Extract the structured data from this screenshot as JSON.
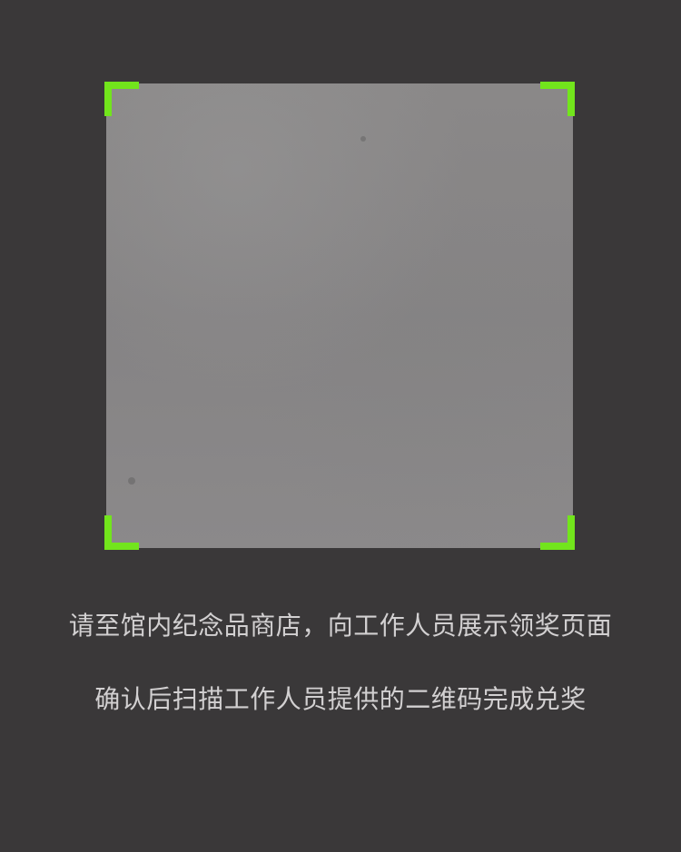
{
  "scanner": {
    "accent_color": "#72e51c",
    "background_color": "#3a3839",
    "camera_preview_color": "#898787"
  },
  "instructions": {
    "line_one": "请至馆内纪念品商店，向工作人员展示领奖页面",
    "line_two": "确认后扫描工作人员提供的二维码完成兑奖"
  }
}
